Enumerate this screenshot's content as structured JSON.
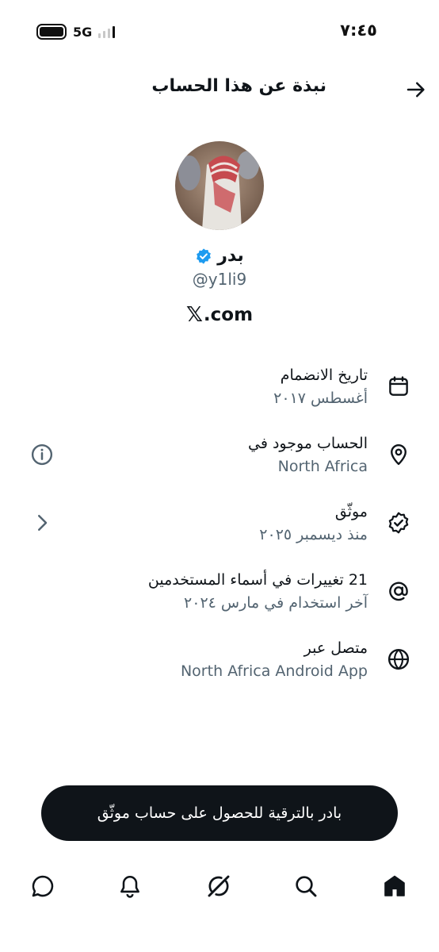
{
  "status_bar": {
    "time": "٧:٤٥",
    "network": "5G",
    "signal_bars_on": 1,
    "signal_bars_total": 4
  },
  "header": {
    "title": "نبذة عن هذا الحساب",
    "back_icon": "arrow-right-icon"
  },
  "profile": {
    "display_name": "بدر",
    "verified_icon": "verified-badge-icon",
    "verified_color": "#1d9bf0",
    "handle": "@y1li9",
    "site_logo": "𝕏",
    "site_suffix": ".com"
  },
  "rows": [
    {
      "icon": "calendar-icon",
      "title": "تاريخ الانضمام",
      "subtitle": "أغسطس ٢٠١٧"
    },
    {
      "icon": "location-pin-icon",
      "title": "الحساب موجود في",
      "subtitle": "North Africa",
      "aux_icon": "info-icon"
    },
    {
      "icon": "verified-check-icon",
      "title": "موثّق",
      "subtitle": "منذ ديسمبر ٢٠٢٥",
      "aux_icon": "chevron-right-icon"
    },
    {
      "icon": "at-sign-icon",
      "title": "21 تغييرات في أسماء المستخدمين",
      "subtitle": "آخر استخدام في مارس ٢٠٢٤"
    },
    {
      "icon": "globe-icon",
      "title": "متصل عبر",
      "subtitle": "North Africa Android App"
    }
  ],
  "cta": {
    "label": "بادر بالترقية للحصول على حساب موثّق"
  },
  "bottom_nav": [
    {
      "icon": "home-icon",
      "active": true
    },
    {
      "icon": "search-icon",
      "active": false
    },
    {
      "icon": "grok-icon",
      "active": false
    },
    {
      "icon": "bell-icon",
      "active": false
    },
    {
      "icon": "messages-icon",
      "active": false
    }
  ]
}
